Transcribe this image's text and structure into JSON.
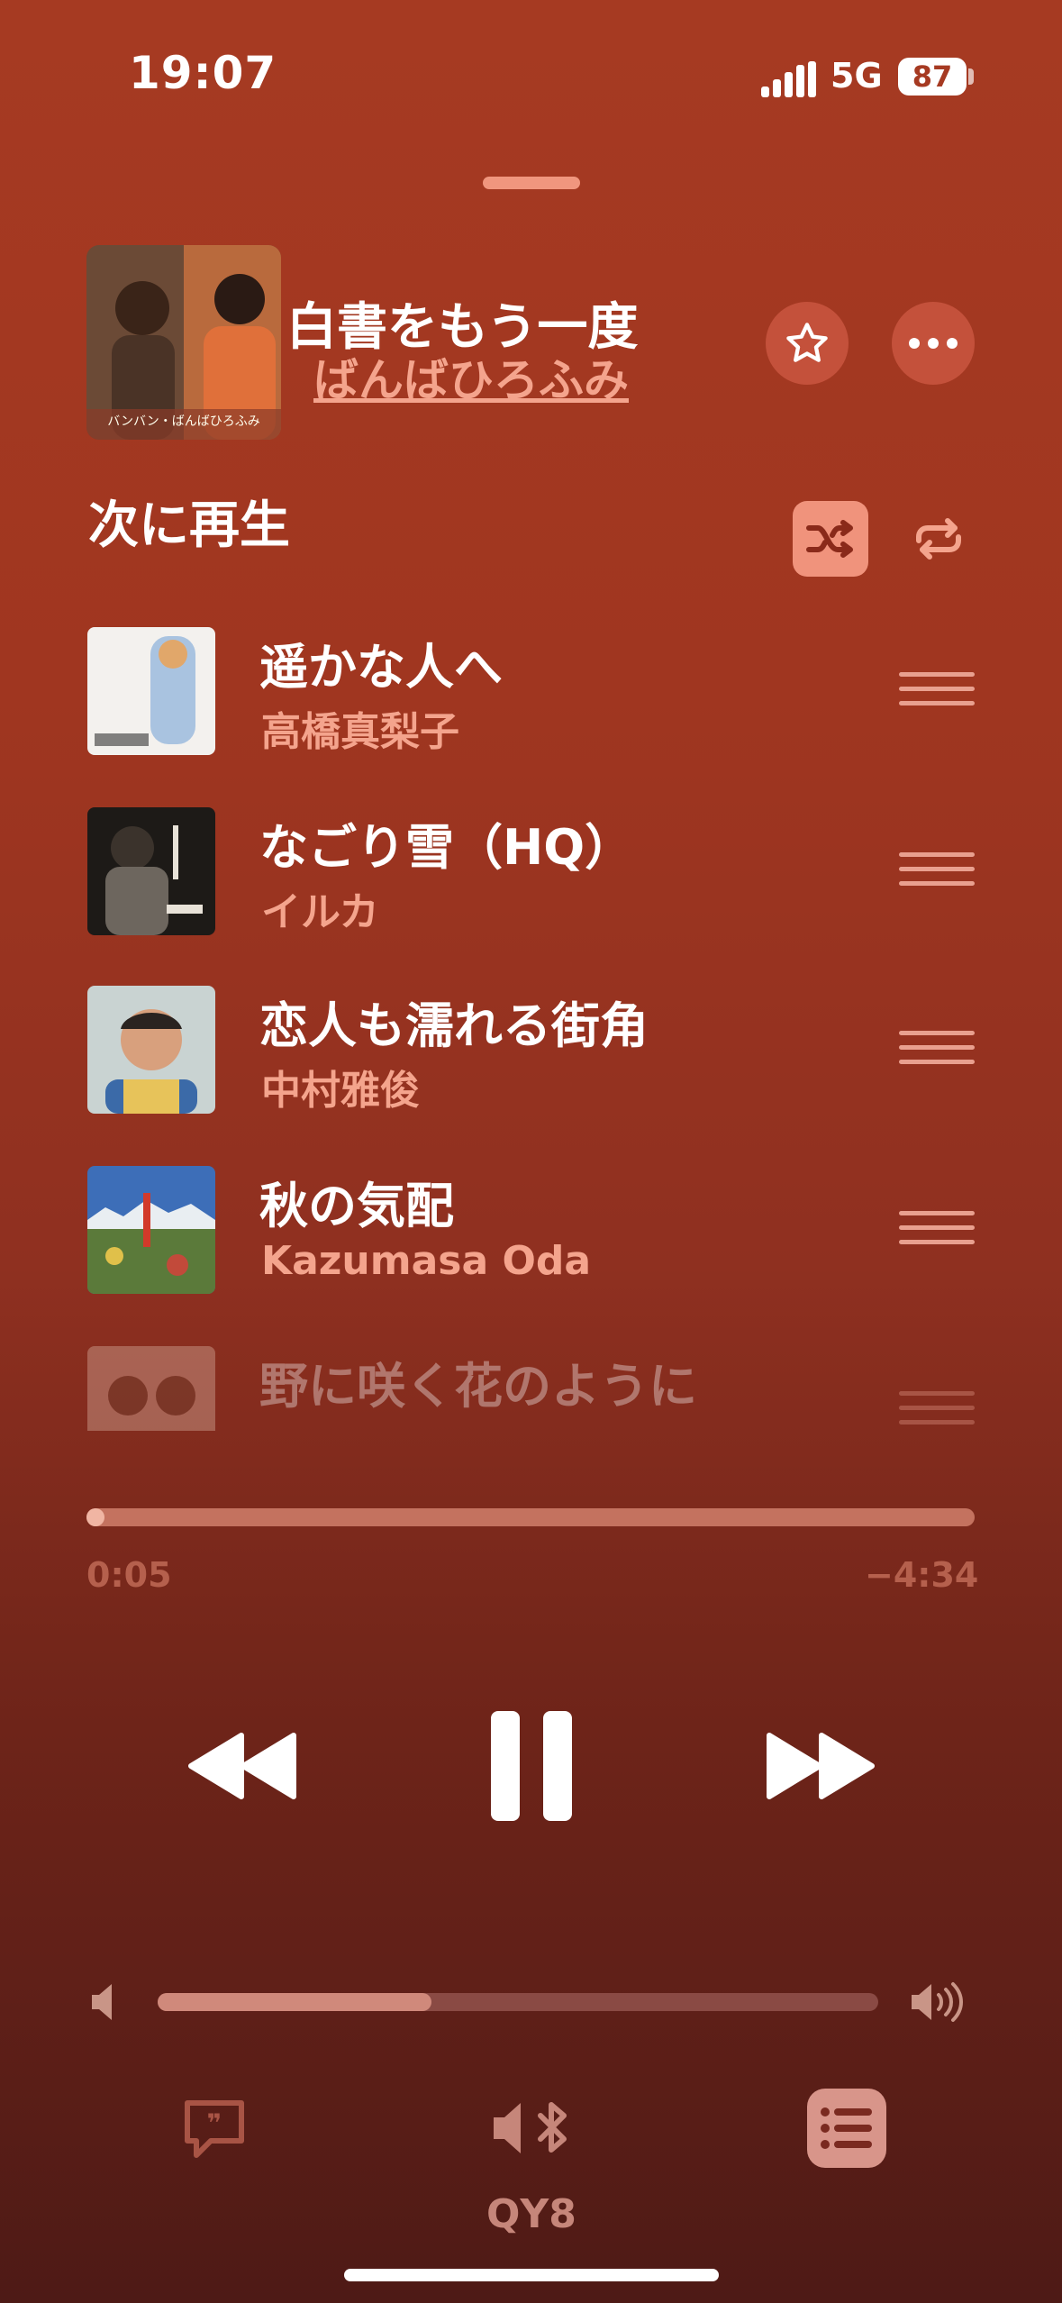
{
  "status_bar": {
    "time": "19:07",
    "network": "5G",
    "battery": "87"
  },
  "now_playing": {
    "title": "白書をもう一度",
    "artist": "ばんばひろふみ",
    "art_caption": "バンバン・ばんばひろふみ"
  },
  "queue": {
    "heading": "次に再生",
    "items": [
      {
        "title": "遥かな人へ",
        "artist": "高橋真梨子"
      },
      {
        "title": "なごり雪（HQ）",
        "artist": "イルカ"
      },
      {
        "title": "恋人も濡れる街角",
        "artist": "中村雅俊"
      },
      {
        "title": "秋の気配",
        "artist": "Kazumasa Oda"
      },
      {
        "title": "野に咲く花のように",
        "artist": ""
      }
    ]
  },
  "playback": {
    "elapsed": "0:05",
    "remaining": "−4:34",
    "progress_fraction": 0.02,
    "volume_fraction": 0.38,
    "output_device": "QY8"
  },
  "colors": {
    "accent": "#f4a48d",
    "background_top": "#a63a22",
    "background_bottom": "#4e1a16"
  }
}
